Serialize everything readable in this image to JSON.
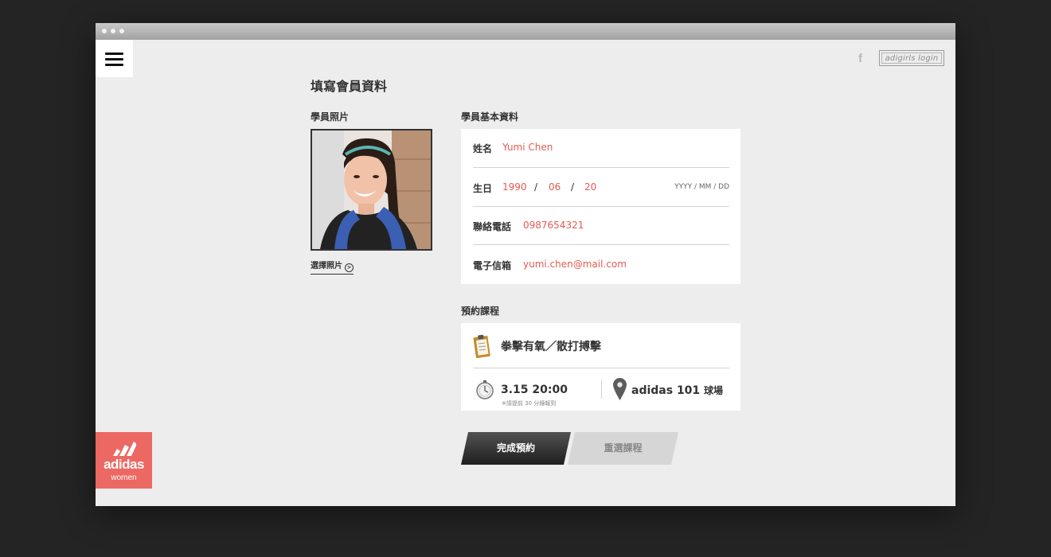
{
  "header": {
    "login_label": "adigirls login",
    "facebook_icon": "f"
  },
  "page_title": "填寫會員資料",
  "photo_section": {
    "label": "學員照片",
    "choose_label": "選擇照片"
  },
  "info_section": {
    "label": "學員基本資料",
    "name": {
      "label": "姓名",
      "value": "Yumi Chen"
    },
    "birthday": {
      "label": "生日",
      "year": "1990",
      "month": "06",
      "day": "20",
      "separator": "/",
      "format_hint": "YYYY / MM / DD"
    },
    "phone": {
      "label": "聯絡電話",
      "value": "0987654321"
    },
    "email": {
      "label": "電子信箱",
      "value": "yumi.chen@mail.com"
    }
  },
  "course_section": {
    "label": "預約課程",
    "course_name": "拳擊有氧／散打搏擊",
    "time": "3.15 20:00",
    "time_note": "※請提前 30 分鐘報到",
    "location_main": "adidas 101",
    "location_suffix": "球場"
  },
  "buttons": {
    "confirm": "完成預約",
    "reset": "重選課程"
  },
  "brand": {
    "name": "adidas",
    "sub": "women",
    "color": "#ec6862"
  },
  "colors": {
    "accent": "#e55a52",
    "background": "#ededed",
    "outer": "#242424"
  }
}
